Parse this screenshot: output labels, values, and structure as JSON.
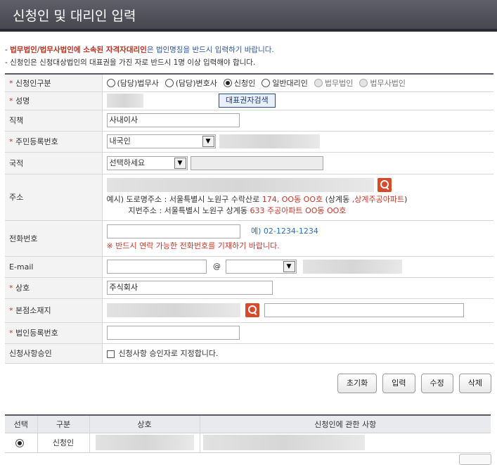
{
  "header": {
    "title": "신청인 및 대리인 입력"
  },
  "notes": {
    "line1_prefix": "- ",
    "line1_em": "법무법인/법무사법인에 소속된 자격자대리인",
    "line1_rest": "은 법인명칭을 반드시 입력하기 바랍니다.",
    "line2": "- 신청인은 신청대상법인의 대표권을 가진 자로 반드시 1명 이상 입력해야 합니다."
  },
  "required_mark": "*",
  "form": {
    "applicant_type": {
      "label": "신청인구분",
      "options": [
        {
          "label": "(담당)법무사",
          "selected": false,
          "disabled": false
        },
        {
          "label": "(담당)변호사",
          "selected": false,
          "disabled": false
        },
        {
          "label": "신청인",
          "selected": true,
          "disabled": false
        },
        {
          "label": "일반대리인",
          "selected": false,
          "disabled": false
        },
        {
          "label": "법무법인",
          "selected": false,
          "disabled": true
        },
        {
          "label": "법무사법인",
          "selected": false,
          "disabled": true
        }
      ]
    },
    "name": {
      "label": "성명",
      "search_button": "대표권자검색"
    },
    "position": {
      "label": "직책",
      "value": "사내이사"
    },
    "resident_no": {
      "label": "주민등록번호",
      "select_value": "내국인"
    },
    "nationality": {
      "label": "국적",
      "select_value": "선택하세요"
    },
    "address": {
      "label": "주소",
      "ex1_prefix": "예시) 도로명주소 : 서울특별시 노원구 수락산로 ",
      "ex1_red": "174, OO동 OO호",
      "ex1_mid": " (상계동 ",
      "ex1_red2": ",상계주공아파트",
      "ex1_end": ")",
      "ex2_prefix": "지번주소 : 서울특별시 노원구 상계동 ",
      "ex2_red": "633 주공아파트 OO동 OO호"
    },
    "phone": {
      "label": "전화번호",
      "example": "예) 02-1234-1234",
      "warning": "※ 반드시 연락 가능한 전화번호를 기재하기 바랍니다."
    },
    "email": {
      "label": "E-mail",
      "at": "@"
    },
    "company": {
      "label": "상호",
      "value": "주식회사"
    },
    "head_office": {
      "label": "본점소재지"
    },
    "corp_reg_no": {
      "label": "법인등록번호"
    },
    "approval": {
      "label": "신청사항승인",
      "checkbox_label": "신청사항 승인자로 지정합니다."
    }
  },
  "buttons": {
    "reset": "초기화",
    "input": "입력",
    "edit": "수정",
    "delete": "삭제"
  },
  "list": {
    "headers": [
      "선택",
      "구분",
      "상호",
      "신청인에 관한 사항"
    ],
    "rows": [
      {
        "type": "신청인",
        "selected": true
      }
    ]
  }
}
